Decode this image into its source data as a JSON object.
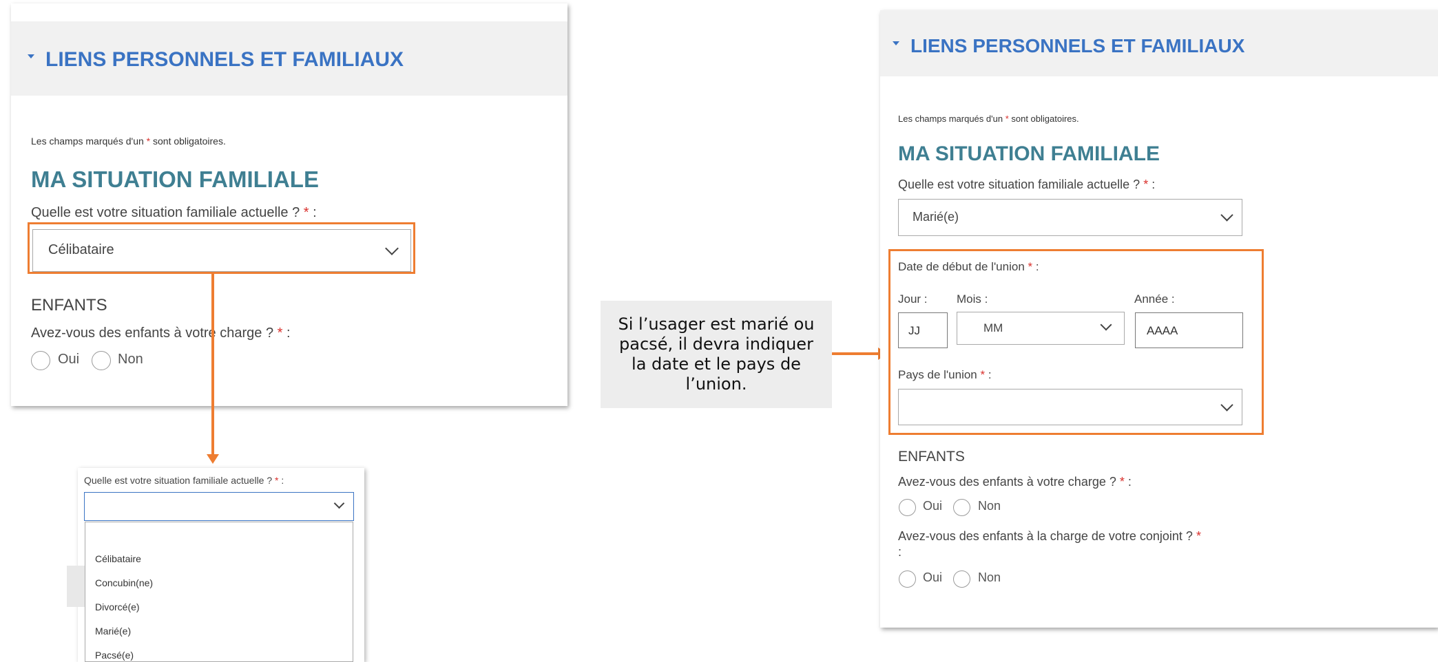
{
  "left_panel": {
    "section_title": "LIENS PERSONNELS ET FAMILIAUX",
    "required_note_prefix": "Les champs marqués d'un ",
    "required_star": "*",
    "required_note_suffix": " sont obligatoires.",
    "situation_heading": "MA SITUATION FAMILIALE",
    "situation_question": "Quelle est votre situation familiale actuelle ?",
    "situation_question_suffix": " :",
    "situation_value": "Célibataire",
    "children_heading": "ENFANTS",
    "children_question": "Avez-vous des enfants à votre charge ?",
    "children_question_suffix": " :",
    "radio_yes": "Oui",
    "radio_no": "Non"
  },
  "dropdown_popup": {
    "question": "Quelle est votre situation familiale actuelle ?",
    "question_suffix": " :",
    "current_value": "",
    "options": [
      "Célibataire",
      "Concubin(ne)",
      "Divorcé(e)",
      "Marié(e)",
      "Pacsé(e)"
    ]
  },
  "callout": {
    "text": "Si l’usager est marié ou pacsé, il devra indiquer la date et le pays de l’union."
  },
  "right_panel": {
    "section_title": "LIENS PERSONNELS ET FAMILIAUX",
    "required_note_prefix": "Les champs marqués d'un ",
    "required_star": "*",
    "required_note_suffix": " sont obligatoires.",
    "situation_heading": "MA SITUATION FAMILIALE",
    "situation_question": "Quelle est votre situation familiale actuelle ?",
    "situation_question_suffix": " :",
    "situation_value": "Marié(e)",
    "union_date_label": "Date de début de l'union",
    "union_date_suffix": " :",
    "day_label": "Jour :",
    "month_label": "Mois :",
    "year_label": "Année :",
    "day_placeholder": "JJ",
    "month_placeholder": "MM",
    "year_placeholder": "AAAA",
    "union_country_label": "Pays de l'union",
    "union_country_suffix": " :",
    "union_country_value": "",
    "children_heading": "ENFANTS",
    "children_question": "Avez-vous des enfants à votre charge ?",
    "children_question_suffix": " :",
    "spouse_children_question": "Avez-vous des enfants à la charge de votre conjoint ?",
    "spouse_children_suffix": ":",
    "radio_yes": "Oui",
    "radio_no": "Non"
  },
  "colors": {
    "accent_orange": "#ee7d31",
    "title_blue": "#3a73c3",
    "heading_teal": "#3f7f92",
    "required_red": "#d9302c"
  }
}
